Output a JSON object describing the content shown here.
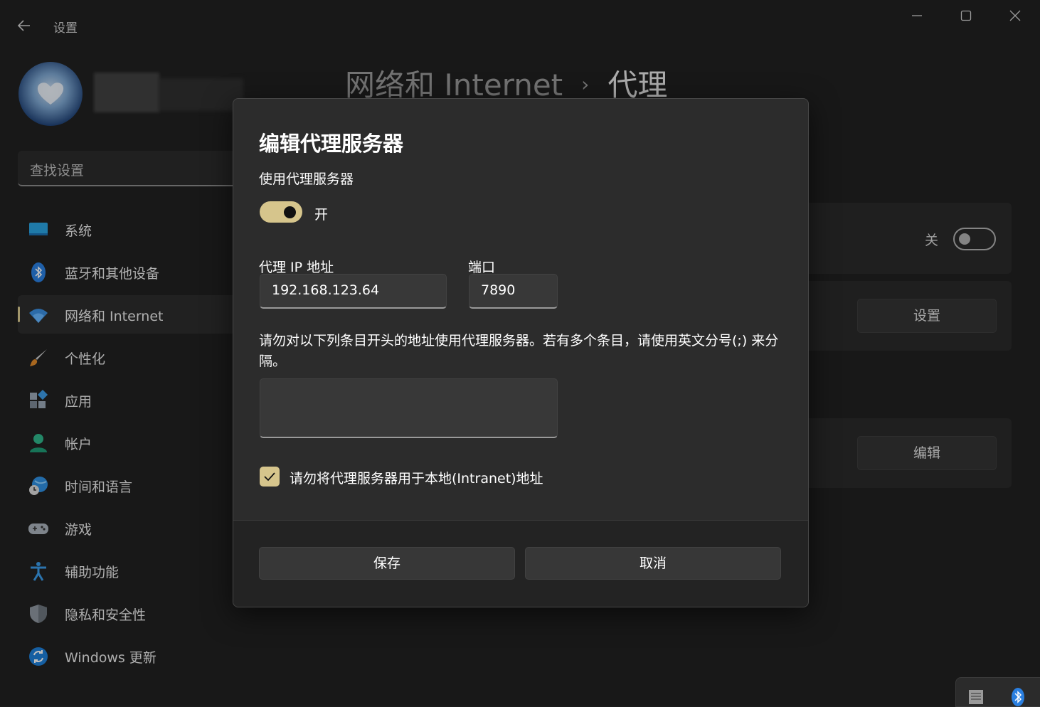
{
  "window": {
    "app_title": "设置",
    "back_icon": "arrow-left-icon",
    "controls": [
      "minimize-icon",
      "maximize-icon",
      "close-icon"
    ]
  },
  "search": {
    "placeholder": "查找设置"
  },
  "sidebar": {
    "items": [
      {
        "label": "系统",
        "icon": "monitor-icon"
      },
      {
        "label": "蓝牙和其他设备",
        "icon": "bluetooth-icon"
      },
      {
        "label": "网络和 Internet",
        "icon": "wifi-icon",
        "selected": true
      },
      {
        "label": "个性化",
        "icon": "brush-icon"
      },
      {
        "label": "应用",
        "icon": "apps-icon"
      },
      {
        "label": "帐户",
        "icon": "person-icon"
      },
      {
        "label": "时间和语言",
        "icon": "globe-clock-icon"
      },
      {
        "label": "游戏",
        "icon": "gamepad-icon"
      },
      {
        "label": "辅助功能",
        "icon": "accessibility-icon"
      },
      {
        "label": "隐私和安全性",
        "icon": "shield-icon"
      },
      {
        "label": "Windows 更新",
        "icon": "update-icon"
      }
    ]
  },
  "header": {
    "breadcrumb_parent": "网络和 Internet",
    "breadcrumb_separator": "›",
    "breadcrumb_current": "代理"
  },
  "background_cards": {
    "auto_detect_state": "关",
    "setup_button": "设置",
    "edit_button": "编辑"
  },
  "dialog": {
    "title": "编辑代理服务器",
    "use_proxy_label": "使用代理服务器",
    "use_proxy_state": "开",
    "ip_label": "代理 IP 地址",
    "ip_value": "192.168.123.64",
    "port_label": "端口",
    "port_value": "7890",
    "exceptions_text": "请勿对以下列条目开头的地址使用代理服务器。若有多个条目，请使用英文分号(;) 来分隔。",
    "exceptions_value": "",
    "local_bypass_label": "请勿将代理服务器用于本地(Intranet)地址",
    "local_bypass_checked": true,
    "save_label": "保存",
    "cancel_label": "取消"
  },
  "colors": {
    "accent": "#d6c58c",
    "background": "#202020",
    "dialog": "#2c2c2c"
  }
}
